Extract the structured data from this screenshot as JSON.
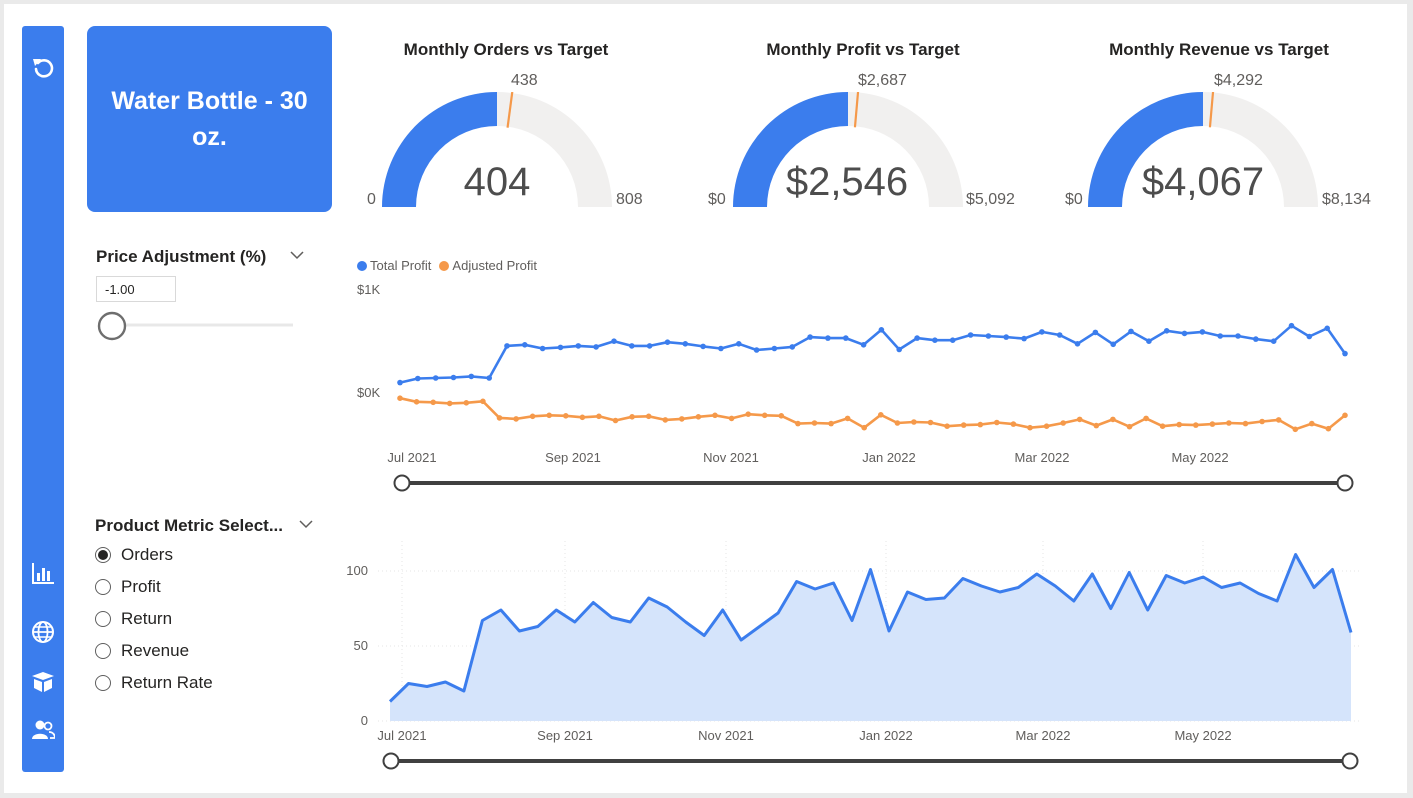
{
  "product": {
    "name": "Water Bottle - 30 oz."
  },
  "sidebar": {
    "icons": [
      "reset-icon",
      "bar-chart-icon",
      "globe-icon",
      "box-icon",
      "users-icon"
    ]
  },
  "gauges": [
    {
      "title": "Monthly Orders vs Target",
      "value": 404,
      "value_label": "404",
      "target": 438,
      "target_label": "438",
      "min": 0,
      "min_label": "0",
      "max": 808,
      "max_label": "808"
    },
    {
      "title": "Monthly Profit vs Target",
      "value": 2546,
      "value_label": "$2,546",
      "target": 2687,
      "target_label": "$2,687",
      "min": 0,
      "min_label": "$0",
      "max": 5092,
      "max_label": "$5,092"
    },
    {
      "title": "Monthly Revenue vs Target",
      "value": 4067,
      "value_label": "$4,067",
      "target": 4292,
      "target_label": "$4,292",
      "min": 0,
      "min_label": "$0",
      "max": 8134,
      "max_label": "$8,134"
    }
  ],
  "price_adjustment": {
    "title": "Price Adjustment (%)",
    "value": "-1.00",
    "slider_position": 0
  },
  "metric_selector": {
    "title": "Product Metric Select...",
    "options": [
      "Orders",
      "Profit",
      "Return",
      "Revenue",
      "Return Rate"
    ],
    "selected": "Orders"
  },
  "colors": {
    "accent": "#3b7ded",
    "orange": "#f5994a",
    "gauge_track": "#f1f0ef",
    "area_fill": "#d5e4fb"
  },
  "chart_data": [
    {
      "type": "line",
      "legend": [
        "Total Profit",
        "Adjusted Profit"
      ],
      "legend_position": "top-left",
      "x_ticks": [
        "Jul 2021",
        "Sep 2021",
        "Nov 2021",
        "Jan 2022",
        "Mar 2022",
        "May 2022"
      ],
      "y_ticks": [
        "$1K",
        "$0K"
      ],
      "grid": false,
      "series": [
        {
          "name": "Total Profit",
          "color": "#3b7ded",
          "values": [
            100,
            140,
            145,
            150,
            160,
            145,
            455,
            465,
            430,
            440,
            455,
            445,
            500,
            455,
            455,
            490,
            475,
            450,
            430,
            475,
            415,
            430,
            445,
            540,
            530,
            530,
            465,
            610,
            420,
            530,
            510,
            510,
            560,
            550,
            540,
            525,
            590,
            560,
            475,
            585,
            470,
            595,
            500,
            600,
            575,
            590,
            550,
            550,
            520,
            500,
            650,
            545,
            625,
            380
          ]
        },
        {
          "name": "Adjusted Profit",
          "color": "#f5994a",
          "values": [
            -50,
            -85,
            -90,
            -100,
            -95,
            -80,
            -240,
            -250,
            -225,
            -215,
            -220,
            -235,
            -225,
            -265,
            -230,
            -225,
            -260,
            -250,
            -230,
            -215,
            -245,
            -205,
            -215,
            -220,
            -295,
            -290,
            -295,
            -245,
            -335,
            -210,
            -290,
            -280,
            -285,
            -320,
            -310,
            -305,
            -285,
            -300,
            -335,
            -320,
            -290,
            -255,
            -315,
            -255,
            -325,
            -245,
            -320,
            -305,
            -310,
            -300,
            -290,
            -295,
            -275,
            -260,
            -350,
            -295,
            -345,
            -215
          ]
        }
      ]
    },
    {
      "type": "area",
      "x_ticks": [
        "Jul 2021",
        "Sep 2021",
        "Nov 2021",
        "Jan 2022",
        "Mar 2022",
        "May 2022"
      ],
      "y_ticks": [
        0,
        50,
        100
      ],
      "ylim": [
        0,
        120
      ],
      "grid": true,
      "series": [
        {
          "name": "Orders",
          "color": "#3b7ded",
          "values": [
            13,
            25,
            23,
            26,
            20,
            67,
            74,
            60,
            63,
            74,
            66,
            79,
            69,
            66,
            82,
            76,
            66,
            57,
            74,
            54,
            63,
            72,
            93,
            88,
            92,
            67,
            101,
            60,
            86,
            81,
            82,
            95,
            90,
            86,
            89,
            98,
            90,
            80,
            98,
            75,
            99,
            74,
            97,
            92,
            96,
            89,
            92,
            85,
            80,
            111,
            89,
            101,
            59
          ]
        }
      ]
    }
  ]
}
